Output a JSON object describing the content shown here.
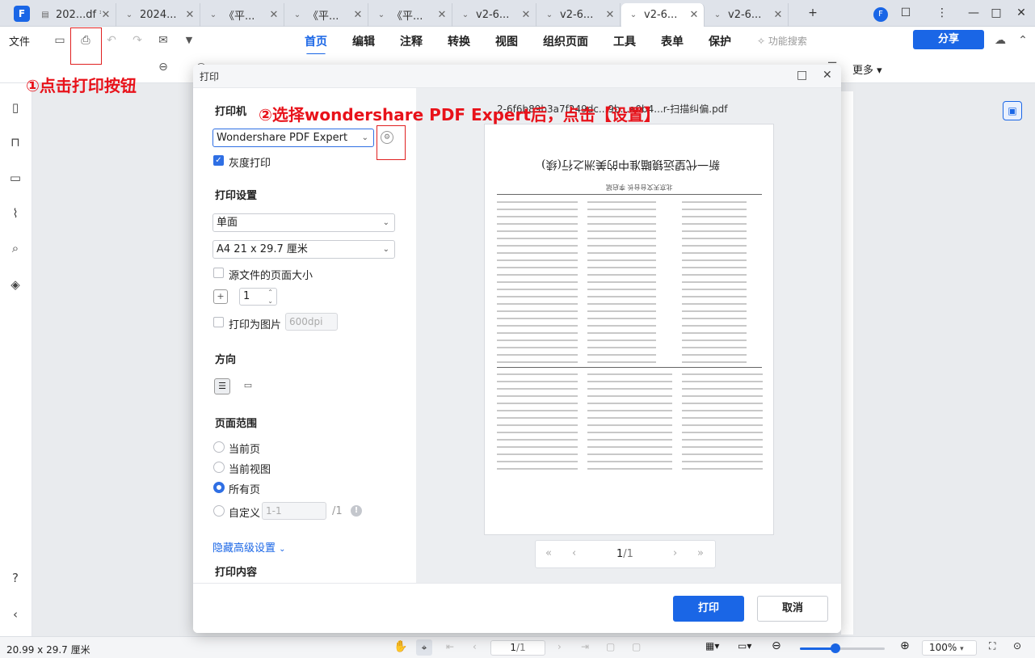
{
  "tabs": [
    {
      "label": "202...df *",
      "active": false
    },
    {
      "label": "2024...",
      "active": false
    },
    {
      "label": "《平...",
      "active": false
    },
    {
      "label": "《平...",
      "active": false
    },
    {
      "label": "《平...",
      "active": false
    },
    {
      "label": "v2-6...",
      "active": false
    },
    {
      "label": "v2-6...",
      "active": false
    },
    {
      "label": "v2-6...",
      "active": true
    },
    {
      "label": "v2-6...",
      "active": false
    }
  ],
  "toolbar": {
    "file": "文件",
    "menus": [
      "首页",
      "编辑",
      "注释",
      "转换",
      "视图",
      "组织页面",
      "工具",
      "表单",
      "保护"
    ],
    "feature_search": "功能搜索",
    "share": "分享",
    "more": "更多"
  },
  "annotations": {
    "step1": "①点击打印按钮",
    "step2": "②选择wondershare PDF Expert后，点击【设置】"
  },
  "dialog": {
    "title": "打印",
    "printer_section": "打印机",
    "printer_value": "Wondershare PDF Expert",
    "grayscale_label": "灰度打印",
    "print_settings_section": "打印设置",
    "sides_value": "单面",
    "paper_value": "A4 21 x 29.7 厘米",
    "source_page_size_label": "源文件的页面大小",
    "copies_value": "1",
    "print_as_image_label": "打印为图片",
    "dpi_placeholder": "600dpi",
    "orientation_section": "方向",
    "page_range_section": "页面范围",
    "range_current_page": "当前页",
    "range_current_view": "当前视图",
    "range_all_pages": "所有页",
    "range_custom": "自定义",
    "custom_placeholder": "1-1",
    "custom_total": "/1",
    "hide_advanced": "隐藏高级设置",
    "print_content_section": "打印内容",
    "file_name": "2-6f6b89b3a7f249dc...9b...a0b4...r-扫描纠偏.pdf",
    "preview_heading": "新一代望远镜瞄准中的美洲之行(续)",
    "preview_subheading": "北京天文台台长  李启斌",
    "page_current": "1",
    "page_total": "/1",
    "print_button": "打印",
    "cancel_button": "取消"
  },
  "statusbar": {
    "page_size": "20.99 x 29.7 厘米",
    "page_current": "1",
    "page_total": "/1",
    "zoom": "100%",
    "zoom_level": 0.42
  },
  "colors": {
    "accent": "#1a66e6",
    "annotation_red": "#e8121a"
  }
}
